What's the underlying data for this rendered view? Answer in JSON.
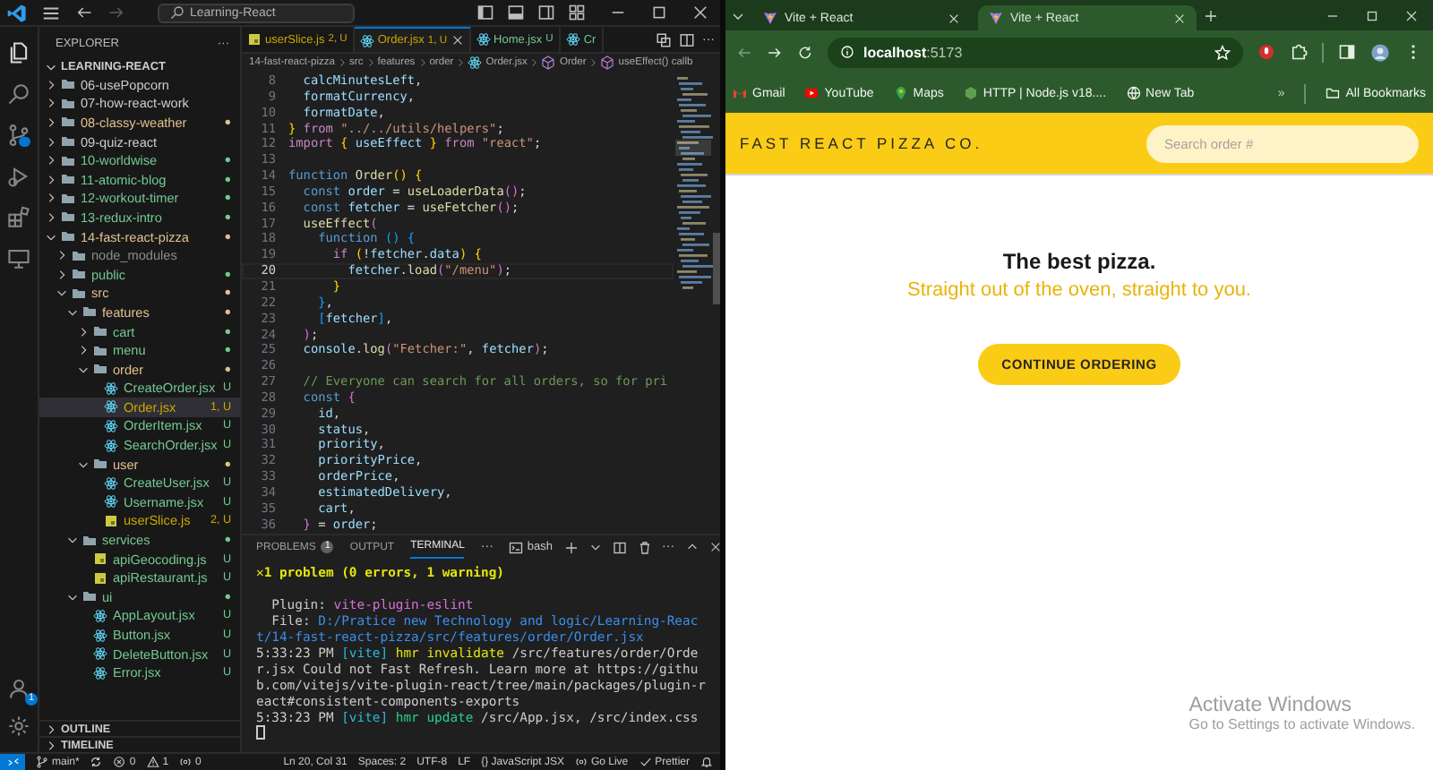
{
  "vscode": {
    "title_bar": {
      "search": "Learning-React"
    },
    "activity_bar": {
      "account_badge": "1"
    },
    "explorer": {
      "title": "EXPLORER",
      "more": "···",
      "workspace": "LEARNING-REACT",
      "tree": [
        {
          "name": "06-usePopcorn",
          "kind": "folder",
          "expanded": false,
          "selected": false,
          "color": "#cccccc"
        },
        {
          "name": "07-how-react-work",
          "kind": "folder",
          "expanded": false,
          "selected": false,
          "color": "#cccccc"
        },
        {
          "name": "08-classy-weather",
          "kind": "folder",
          "expanded": false,
          "selected": false,
          "color": "#e2c08d",
          "badge": "●"
        },
        {
          "name": "09-quiz-react",
          "kind": "folder",
          "expanded": false,
          "selected": false,
          "color": "#cccccc"
        },
        {
          "name": "10-worldwise",
          "kind": "folder",
          "expanded": false,
          "selected": false,
          "color": "#73c991",
          "badge": "●"
        },
        {
          "name": "11-atomic-blog",
          "kind": "folder",
          "expanded": false,
          "selected": false,
          "color": "#73c991",
          "badge": "●"
        },
        {
          "name": "12-workout-timer",
          "kind": "folder",
          "expanded": false,
          "selected": false,
          "color": "#73c991",
          "badge": "●"
        },
        {
          "name": "13-redux-intro",
          "kind": "folder",
          "expanded": false,
          "selected": false,
          "color": "#73c991",
          "badge": "●"
        },
        {
          "name": "14-fast-react-pizza",
          "kind": "folder",
          "expanded": true,
          "selected": false,
          "color": "#e2c08d",
          "badge": "●",
          "children": [
            {
              "name": "node_modules",
              "kind": "folder",
              "expanded": false,
              "selected": false,
              "color": "#8c8c8c"
            },
            {
              "name": "public",
              "kind": "folder",
              "expanded": false,
              "selected": false,
              "color": "#73c991",
              "badge": "●"
            },
            {
              "name": "src",
              "kind": "folder",
              "expanded": true,
              "selected": false,
              "color": "#e2c08d",
              "badge": "●",
              "children": [
                {
                  "name": "features",
                  "kind": "folder",
                  "expanded": true,
                  "selected": false,
                  "color": "#e2c08d",
                  "badge": "●",
                  "children": [
                    {
                      "name": "cart",
                      "kind": "folder",
                      "expanded": false,
                      "selected": false,
                      "color": "#73c991",
                      "badge": "●"
                    },
                    {
                      "name": "menu",
                      "kind": "folder",
                      "expanded": false,
                      "selected": false,
                      "color": "#73c991",
                      "badge": "●"
                    },
                    {
                      "name": "order",
                      "kind": "folder",
                      "expanded": true,
                      "selected": false,
                      "color": "#e2c08d",
                      "badge": "●",
                      "children": [
                        {
                          "name": "CreateOrder.jsx",
                          "kind": "jsx",
                          "selected": false,
                          "color": "#73c991",
                          "badge": "U"
                        },
                        {
                          "name": "Order.jsx",
                          "kind": "jsx",
                          "selected": true,
                          "color": "#cca700",
                          "badge": "1, U"
                        },
                        {
                          "name": "OrderItem.jsx",
                          "kind": "jsx",
                          "selected": false,
                          "color": "#73c991",
                          "badge": "U"
                        },
                        {
                          "name": "SearchOrder.jsx",
                          "kind": "jsx",
                          "selected": false,
                          "color": "#73c991",
                          "badge": "U"
                        }
                      ]
                    },
                    {
                      "name": "user",
                      "kind": "folder",
                      "expanded": true,
                      "selected": false,
                      "color": "#e2c08d",
                      "badge": "●",
                      "children": [
                        {
                          "name": "CreateUser.jsx",
                          "kind": "jsx",
                          "selected": false,
                          "color": "#73c991",
                          "badge": "U"
                        },
                        {
                          "name": "Username.jsx",
                          "kind": "jsx",
                          "selected": false,
                          "color": "#73c991",
                          "badge": "U"
                        },
                        {
                          "name": "userSlice.js",
                          "kind": "js",
                          "selected": false,
                          "color": "#cca700",
                          "badge": "2, U"
                        }
                      ]
                    }
                  ]
                },
                {
                  "name": "services",
                  "kind": "folder",
                  "expanded": true,
                  "selected": false,
                  "color": "#73c991",
                  "badge": "●",
                  "children": [
                    {
                      "name": "apiGeocoding.js",
                      "kind": "js",
                      "selected": false,
                      "color": "#73c991",
                      "badge": "U"
                    },
                    {
                      "name": "apiRestaurant.js",
                      "kind": "js",
                      "selected": false,
                      "color": "#73c991",
                      "badge": "U"
                    }
                  ]
                },
                {
                  "name": "ui",
                  "kind": "folder",
                  "expanded": true,
                  "selected": false,
                  "color": "#73c991",
                  "badge": "●",
                  "children": [
                    {
                      "name": "AppLayout.jsx",
                      "kind": "jsx",
                      "selected": false,
                      "color": "#73c991",
                      "badge": "U"
                    },
                    {
                      "name": "Button.jsx",
                      "kind": "jsx",
                      "selected": false,
                      "color": "#73c991",
                      "badge": "U"
                    },
                    {
                      "name": "DeleteButton.jsx",
                      "kind": "jsx",
                      "selected": false,
                      "color": "#73c991",
                      "badge": "U"
                    },
                    {
                      "name": "Error.jsx",
                      "kind": "jsx",
                      "selected": false,
                      "color": "#73c991",
                      "badge": "U"
                    }
                  ]
                }
              ]
            }
          ]
        }
      ],
      "sections": [
        "OUTLINE",
        "TIMELINE"
      ]
    },
    "editor": {
      "tabs": [
        {
          "label": "userSlice.js",
          "kind": "js",
          "badge": "2, U",
          "color": "#cca700",
          "selected": false
        },
        {
          "label": "Order.jsx",
          "kind": "jsx",
          "badge": "1, U",
          "color": "#cca700",
          "selected": true
        },
        {
          "label": "Home.jsx",
          "kind": "jsx",
          "badge": "U",
          "color": "#73c991",
          "selected": false
        },
        {
          "label": "Cr",
          "kind": "jsx",
          "color": "#73c991",
          "selected": false
        }
      ],
      "more": "···",
      "breadcrumbs": [
        {
          "text": "14-fast-react-pizza",
          "kind": "folder"
        },
        {
          "text": "src",
          "kind": "folder"
        },
        {
          "text": "features",
          "kind": "folder"
        },
        {
          "text": "order",
          "kind": "folder"
        },
        {
          "text": "Order.jsx",
          "kind": "file"
        },
        {
          "text": "Order",
          "kind": "symbol"
        },
        {
          "text": "useEffect() callb",
          "kind": "symbol"
        }
      ],
      "lines": [
        {
          "number": "8",
          "active": false,
          "tokens": [
            {
              "text": "  calcMinutesLeft",
              "kind": "var"
            },
            {
              "text": ",",
              "kind": "punct"
            }
          ]
        },
        {
          "number": "9",
          "active": false,
          "tokens": [
            {
              "text": "  formatCurrency",
              "kind": "var"
            },
            {
              "text": ",",
              "kind": "punct"
            }
          ]
        },
        {
          "number": "10",
          "active": false,
          "tokens": [
            {
              "text": "  formatDate",
              "kind": "var"
            },
            {
              "text": ",",
              "kind": "punct"
            }
          ]
        },
        {
          "number": "11",
          "active": false,
          "tokens": [
            {
              "text": "}",
              "kind": "b1"
            },
            {
              "text": " from ",
              "kind": "kw"
            },
            {
              "text": "\"../../utils/helpers\"",
              "kind": "str"
            },
            {
              "text": ";",
              "kind": "punct"
            }
          ]
        },
        {
          "number": "12",
          "active": false,
          "tokens": [
            {
              "text": "import ",
              "kind": "kw"
            },
            {
              "text": "{",
              "kind": "b1"
            },
            {
              "text": " useEffect ",
              "kind": "var"
            },
            {
              "text": "}",
              "kind": "b1"
            },
            {
              "text": " from ",
              "kind": "kw"
            },
            {
              "text": "\"react\"",
              "kind": "str"
            },
            {
              "text": ";",
              "kind": "punct"
            }
          ]
        },
        {
          "number": "13",
          "active": false
        },
        {
          "number": "14",
          "active": false,
          "tokens": [
            {
              "text": "function ",
              "kind": "storage"
            },
            {
              "text": "Order",
              "kind": "fn"
            },
            {
              "text": "() {",
              "kind": "b1"
            }
          ]
        },
        {
          "number": "15",
          "active": false,
          "tokens": [
            {
              "text": "  const ",
              "kind": "storage"
            },
            {
              "text": "order",
              "kind": "var"
            },
            {
              "text": " = ",
              "kind": "punct"
            },
            {
              "text": "useLoaderData",
              "kind": "fn"
            },
            {
              "text": "()",
              "kind": "b2"
            },
            {
              "text": ";",
              "kind": "punct"
            }
          ]
        },
        {
          "number": "16",
          "active": false,
          "tokens": [
            {
              "text": "  const ",
              "kind": "storage"
            },
            {
              "text": "fetcher",
              "kind": "var"
            },
            {
              "text": " = ",
              "kind": "punct"
            },
            {
              "text": "useFetcher",
              "kind": "fn"
            },
            {
              "text": "()",
              "kind": "b2"
            },
            {
              "text": ";",
              "kind": "punct"
            }
          ]
        },
        {
          "number": "17",
          "active": false,
          "tokens": [
            {
              "text": "  useEffect",
              "kind": "fn"
            },
            {
              "text": "(",
              "kind": "b2"
            }
          ]
        },
        {
          "number": "18",
          "active": false,
          "tokens": [
            {
              "text": "    function ",
              "kind": "storage"
            },
            {
              "text": "() {",
              "kind": "b3"
            }
          ]
        },
        {
          "number": "19",
          "active": false,
          "tokens": [
            {
              "text": "      if ",
              "kind": "kw"
            },
            {
              "text": "(",
              "kind": "b1"
            },
            {
              "text": "!",
              "kind": "punct"
            },
            {
              "text": "fetcher",
              "kind": "var"
            },
            {
              "text": ".",
              "kind": "punct"
            },
            {
              "text": "data",
              "kind": "var"
            },
            {
              "text": ") {",
              "kind": "b1"
            }
          ]
        },
        {
          "number": "20",
          "active": true,
          "tokens": [
            {
              "text": "        fetcher",
              "kind": "var"
            },
            {
              "text": ".",
              "kind": "punct"
            },
            {
              "text": "load",
              "kind": "fn"
            },
            {
              "text": "(",
              "kind": "b2"
            },
            {
              "text": "\"/menu\"",
              "kind": "str"
            },
            {
              "text": ")",
              "kind": "b2"
            },
            {
              "text": ";",
              "kind": "punct"
            }
          ]
        },
        {
          "number": "21",
          "active": false,
          "tokens": [
            {
              "text": "      }",
              "kind": "b1"
            }
          ]
        },
        {
          "number": "22",
          "active": false,
          "tokens": [
            {
              "text": "    }",
              "kind": "b3"
            },
            {
              "text": ",",
              "kind": "punct"
            }
          ]
        },
        {
          "number": "23",
          "active": false,
          "tokens": [
            {
              "text": "    [",
              "kind": "b3"
            },
            {
              "text": "fetcher",
              "kind": "var"
            },
            {
              "text": "]",
              "kind": "b3"
            },
            {
              "text": ",",
              "kind": "punct"
            }
          ]
        },
        {
          "number": "24",
          "active": false,
          "tokens": [
            {
              "text": "  )",
              "kind": "b2"
            },
            {
              "text": ";",
              "kind": "punct"
            }
          ]
        },
        {
          "number": "25",
          "active": false,
          "tokens": [
            {
              "text": "  console",
              "kind": "var"
            },
            {
              "text": ".",
              "kind": "punct"
            },
            {
              "text": "log",
              "kind": "fn"
            },
            {
              "text": "(",
              "kind": "b2"
            },
            {
              "text": "\"Fetcher:\"",
              "kind": "str"
            },
            {
              "text": ", ",
              "kind": "punct"
            },
            {
              "text": "fetcher",
              "kind": "var"
            },
            {
              "text": ")",
              "kind": "b2"
            },
            {
              "text": ";",
              "kind": "punct"
            }
          ]
        },
        {
          "number": "26",
          "active": false
        },
        {
          "number": "27",
          "active": false,
          "tokens": [
            {
              "text": "  // Everyone can search for all orders, so for pri",
              "kind": "comment"
            }
          ]
        },
        {
          "number": "28",
          "active": false,
          "tokens": [
            {
              "text": "  const ",
              "kind": "storage"
            },
            {
              "text": "{",
              "kind": "b2"
            }
          ]
        },
        {
          "number": "29",
          "active": false,
          "tokens": [
            {
              "text": "    id",
              "kind": "var"
            },
            {
              "text": ",",
              "kind": "punct"
            }
          ]
        },
        {
          "number": "30",
          "active": false,
          "tokens": [
            {
              "text": "    status",
              "kind": "var"
            },
            {
              "text": ",",
              "kind": "punct"
            }
          ]
        },
        {
          "number": "31",
          "active": false,
          "tokens": [
            {
              "text": "    priority",
              "kind": "var"
            },
            {
              "text": ",",
              "kind": "punct"
            }
          ]
        },
        {
          "number": "32",
          "active": false,
          "tokens": [
            {
              "text": "    priorityPrice",
              "kind": "var"
            },
            {
              "text": ",",
              "kind": "punct"
            }
          ]
        },
        {
          "number": "33",
          "active": false,
          "tokens": [
            {
              "text": "    orderPrice",
              "kind": "var"
            },
            {
              "text": ",",
              "kind": "punct"
            }
          ]
        },
        {
          "number": "34",
          "active": false,
          "tokens": [
            {
              "text": "    estimatedDelivery",
              "kind": "var"
            },
            {
              "text": ",",
              "kind": "punct"
            }
          ]
        },
        {
          "number": "35",
          "active": false,
          "tokens": [
            {
              "text": "    cart",
              "kind": "var"
            },
            {
              "text": ",",
              "kind": "punct"
            }
          ]
        },
        {
          "number": "36",
          "active": false,
          "tokens": [
            {
              "text": "  }",
              "kind": "b2"
            },
            {
              "text": " = ",
              "kind": "punct"
            },
            {
              "text": "order",
              "kind": "var"
            },
            {
              "text": ";",
              "kind": "punct"
            }
          ]
        }
      ]
    },
    "panel": {
      "tabs": [
        {
          "label": "PROBLEMS",
          "badge": "1",
          "selected": false
        },
        {
          "label": "OUTPUT",
          "selected": false
        },
        {
          "label": "TERMINAL",
          "selected": true
        }
      ],
      "more": "···",
      "shell": "bash",
      "actions_more": "···",
      "terminal": [
        {
          "segments": [
            {
              "text": "✕1 problem (0 errors, 1 warning)",
              "kind": "warn"
            }
          ]
        },
        {
          "kind": "blank"
        },
        {
          "segments": [
            {
              "text": "  Plugin: ",
              "kind": "plain"
            },
            {
              "text": "vite-plugin-eslint",
              "kind": "magenta"
            }
          ]
        },
        {
          "segments": [
            {
              "text": "  File: ",
              "kind": "plain"
            },
            {
              "text": "D:/Pratice new Technology and logic/Learning-React/14-fast-react-pizza/src/features/order/Order.jsx",
              "kind": "path"
            }
          ]
        },
        {
          "segments": [
            {
              "text": "5:33:23 PM ",
              "kind": "plain"
            },
            {
              "text": "[vite]",
              "kind": "cyan"
            },
            {
              "text": " hmr invalidate",
              "kind": "yellow"
            },
            {
              "text": " /src/features/order/Order.jsx Could not Fast Refresh. Learn more at https://github.com/vitejs/vite-plugin-react/tree/main/packages/plugin-react#consistent-components-exports",
              "kind": "plain"
            }
          ]
        },
        {
          "segments": [
            {
              "text": "5:33:23 PM ",
              "kind": "plain"
            },
            {
              "text": "[vite]",
              "kind": "cyan"
            },
            {
              "text": " hmr update",
              "kind": "green"
            },
            {
              "text": " /src/App.jsx, /src/index.css",
              "kind": "plain"
            }
          ]
        }
      ]
    },
    "status_bar": {
      "left": [
        {
          "kind": "branch",
          "text": "main*"
        },
        {
          "kind": "errors",
          "text": "0"
        },
        {
          "kind": "warnings",
          "text": "1"
        },
        {
          "kind": "ports",
          "text": "0"
        }
      ],
      "right": [
        {
          "kind": "text",
          "text": "Ln 20, Col 31"
        },
        {
          "kind": "text",
          "text": "Spaces: 2"
        },
        {
          "kind": "text",
          "text": "UTF-8"
        },
        {
          "kind": "text",
          "text": "LF"
        },
        {
          "kind": "text",
          "text": "{} JavaScript JSX"
        },
        {
          "kind": "live",
          "text": "Go Live"
        },
        {
          "kind": "prettier",
          "text": "Prettier"
        }
      ]
    }
  },
  "browser": {
    "tabs": [
      {
        "title": "Vite + React",
        "selected": false
      },
      {
        "title": "Vite + React",
        "selected": true
      }
    ],
    "address": {
      "host": "localhost",
      "port": ":5173"
    },
    "bookmarks": [
      {
        "label": "Gmail",
        "kind": "gmail"
      },
      {
        "label": "YouTube",
        "kind": "youtube"
      },
      {
        "label": "Maps",
        "kind": "maps"
      },
      {
        "label": "HTTP | Node.js v18....",
        "kind": "node"
      },
      {
        "label": "New Tab",
        "kind": "globe"
      }
    ],
    "overflow": "»",
    "all_bookmarks": "All Bookmarks",
    "page": {
      "brand": "FAST REACT PIZZA CO.",
      "search": {
        "placeholder": "Search order #"
      },
      "heading": "The best pizza.",
      "subheading": "Straight out of the oven, straight to you.",
      "button": "CONTINUE ORDERING"
    }
  },
  "system_notice": {
    "title": "Activate Windows",
    "text": "Go to Settings to activate Windows."
  }
}
